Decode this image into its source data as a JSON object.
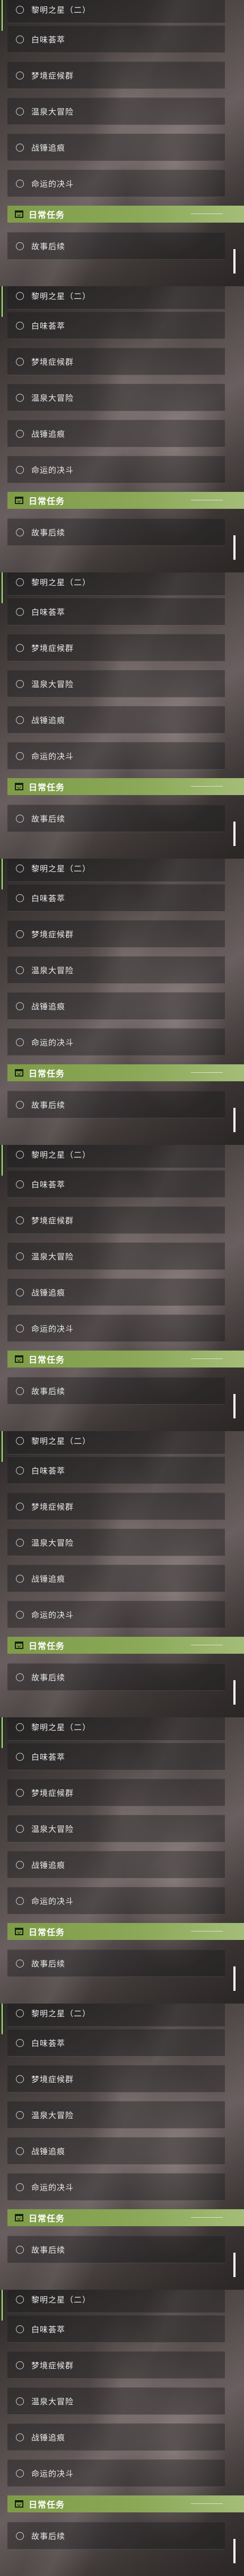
{
  "task_list": {
    "scene_label": "黎明之星（二）",
    "quests": [
      "白味荟萃",
      "梦境症候群",
      "温泉大冒险",
      "战锤追痕",
      "命运的决斗"
    ],
    "daily_section_label": "日常任务",
    "daily_quest": "故事后续",
    "repeat_count": 9
  },
  "colors": {
    "accent": "#a9ff7a",
    "daily_header": "#86a452",
    "text": "#ececec"
  },
  "icons": {
    "quest_marker": "circle-outline-icon",
    "daily_header": "calendar-check-icon",
    "scroll": "scrollbar-thumb"
  }
}
